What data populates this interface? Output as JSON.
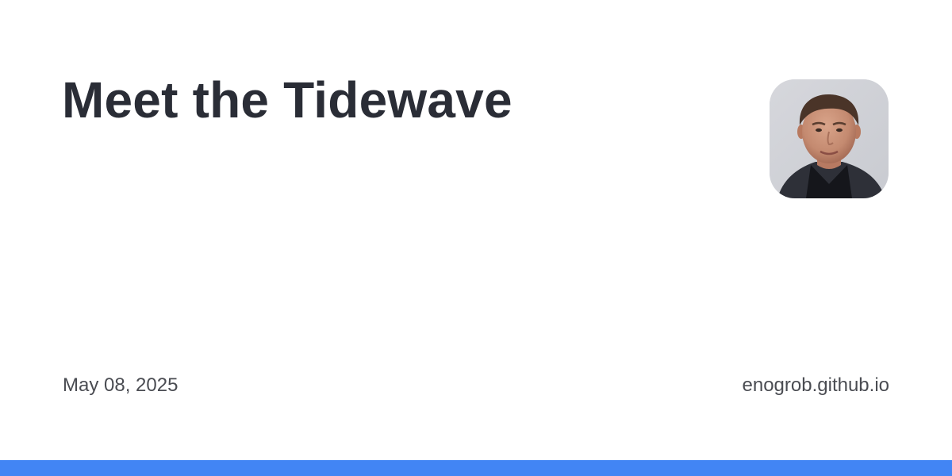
{
  "post": {
    "title": "Meet the Tidewave",
    "date": "May 08, 2025",
    "site": "enogrob.github.io"
  },
  "avatar": {
    "icon": "author-portrait"
  },
  "colors": {
    "background": "#ffffff",
    "title": "#2a2d36",
    "meta_text": "#4a4c52",
    "accent_bar": "#4285f4"
  }
}
